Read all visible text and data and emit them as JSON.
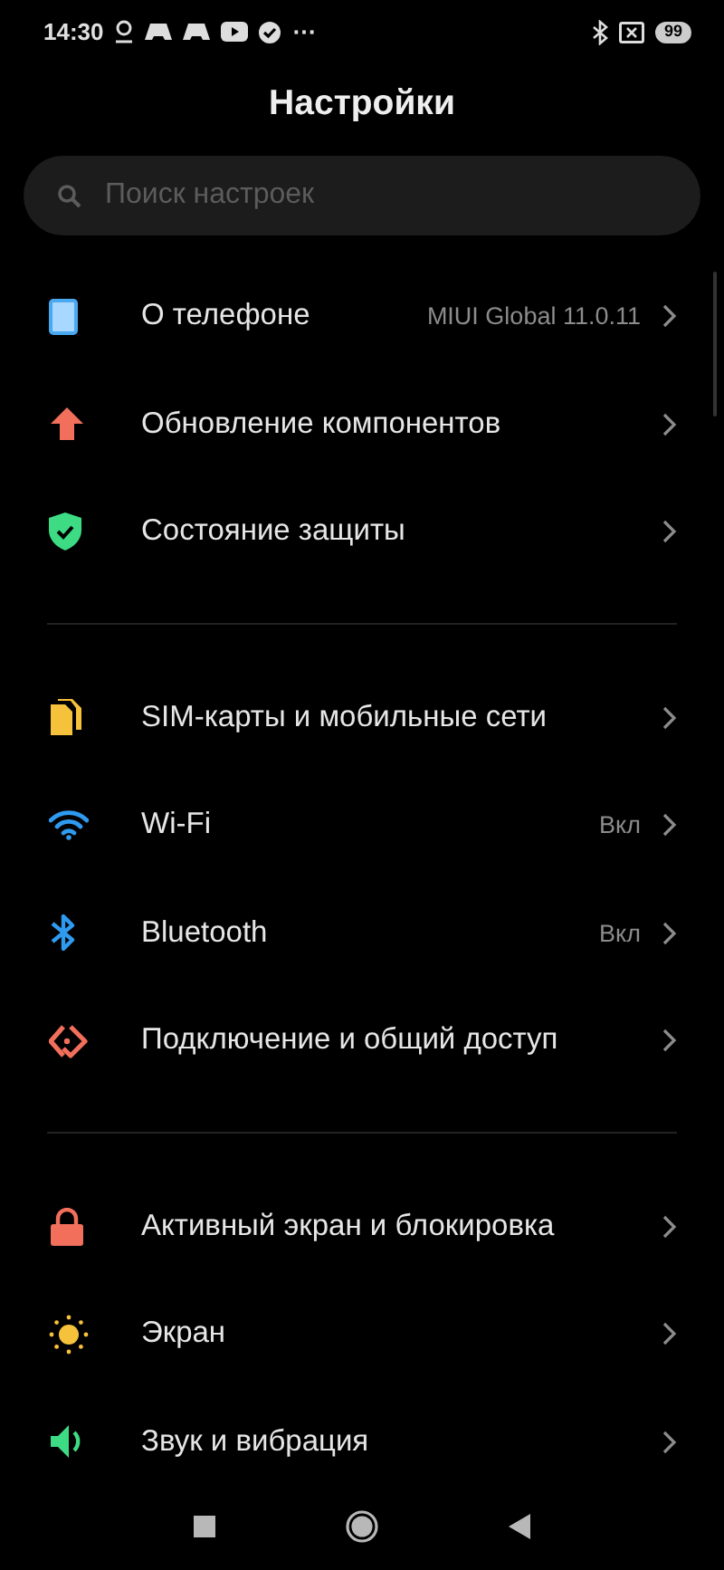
{
  "status_bar": {
    "time": "14:30",
    "more": "⋯",
    "battery": "99"
  },
  "title": "Настройки",
  "search": {
    "placeholder": "Поиск настроек"
  },
  "sections": [
    {
      "items": [
        {
          "kind": "phone",
          "label": "О телефоне",
          "value": "MIUI Global 11.0.11"
        },
        {
          "kind": "update",
          "label": "Обновление компонентов"
        },
        {
          "kind": "shield",
          "label": "Состояние защиты"
        }
      ]
    },
    {
      "items": [
        {
          "kind": "sim",
          "label": "SIM-карты и мобильные сети"
        },
        {
          "kind": "wifi",
          "label": "Wi-Fi",
          "value": "Вкл"
        },
        {
          "kind": "bluetooth",
          "label": "Bluetooth",
          "value": "Вкл"
        },
        {
          "kind": "share",
          "label": "Подключение и общий доступ"
        }
      ]
    },
    {
      "items": [
        {
          "kind": "lock",
          "label": "Активный экран и блокировка"
        },
        {
          "kind": "display",
          "label": "Экран"
        },
        {
          "kind": "sound",
          "label": "Звук и вибрация"
        }
      ]
    }
  ]
}
